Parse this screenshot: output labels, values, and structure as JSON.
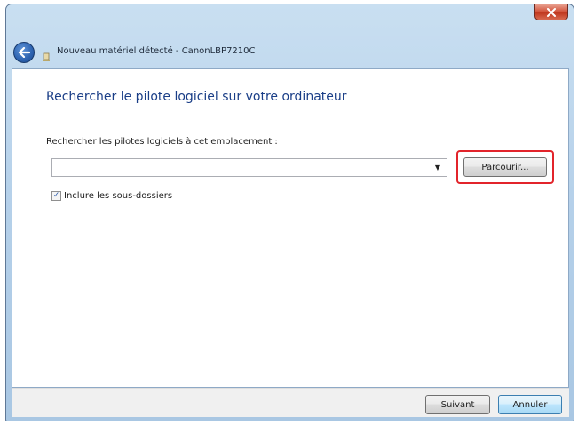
{
  "window": {
    "title": "Nouveau matériel détecté - CanonLBP7210C",
    "close_icon": "close-icon",
    "back_icon": "back-arrow-icon",
    "device_icon": "hardware-icon"
  },
  "main": {
    "heading": "Rechercher le pilote logiciel sur votre ordinateur",
    "location_label": "Rechercher les pilotes logiciels à cet emplacement :",
    "location_value": "",
    "location_dropdown_icon": "dropdown-arrow-icon",
    "browse_label": "Parcourir...",
    "include_subfolders_label": "Inclure les sous-dossiers",
    "include_subfolders_checked": true,
    "highlight_color": "#e2242b"
  },
  "footer": {
    "next_label": "Suivant",
    "cancel_label": "Annuler"
  }
}
